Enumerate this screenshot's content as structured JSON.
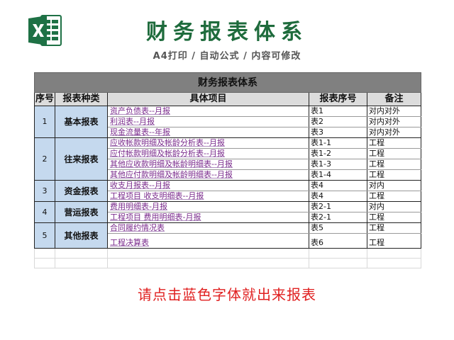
{
  "header": {
    "title": "财务报表体系",
    "subtitle": "A4打印 / 自动公式 / 内容可修改"
  },
  "sheet": {
    "banner": "财务报表体系",
    "columns": [
      "序号",
      "报表种类",
      "具体项目",
      "报表序号",
      "备注"
    ],
    "groups": [
      {
        "no": "1",
        "type": "基本报表",
        "rows": [
          {
            "item": "资产负债表--月报",
            "code": "表1",
            "note": "对内对外"
          },
          {
            "item": "利润表--月报",
            "code": "表2",
            "note": "对内对外"
          },
          {
            "item": "现金流量表--年报",
            "code": "表3",
            "note": "对内对外"
          }
        ]
      },
      {
        "no": "2",
        "type": "往来报表",
        "rows": [
          {
            "item": "应收帐款明细及帐龄分析表--月报",
            "code": "表1-1",
            "note": "工程"
          },
          {
            "item": "应付帐款明细及帐龄分析表--月报",
            "code": "表1-2",
            "note": "工程"
          },
          {
            "item": "其他应收款明细及帐龄明细表--月报",
            "code": "表1-3",
            "note": "工程"
          },
          {
            "item": "其他应付款明细及帐龄明细表--月报",
            "code": "表1-4",
            "note": "工程"
          }
        ]
      },
      {
        "no": "3",
        "type": "资金报表",
        "rows": [
          {
            "item": "收支月报表--月报",
            "code": "表4",
            "note": "对内"
          },
          {
            "item": "工程项目  收支明细表--月报",
            "code": "表4",
            "note": "工程"
          }
        ]
      },
      {
        "no": "4",
        "type": "营运报表",
        "rows": [
          {
            "item": "费用明细表-月报",
            "code": "表2-1",
            "note": "对内"
          },
          {
            "item": "工程项目   费用明细表-月报",
            "code": "表2-1",
            "note": "工程"
          }
        ]
      },
      {
        "no": "5",
        "type": "其他报表",
        "rows": [
          {
            "item": "合同履约情况表",
            "code": "表5",
            "note": "工程"
          },
          {
            "item": "工程决算表",
            "code": "表6",
            "note": "工程"
          }
        ]
      }
    ]
  },
  "notice": "请点击蓝色字体就出来报表",
  "colors": {
    "title": "#1e6b3c",
    "banner": "#808080",
    "group_fill": "#c5d9ee",
    "link_text": "#7a2a8c",
    "notice": "#e02020",
    "logo": "#1e7145"
  },
  "icons": {
    "logo": "excel-logo-icon"
  }
}
